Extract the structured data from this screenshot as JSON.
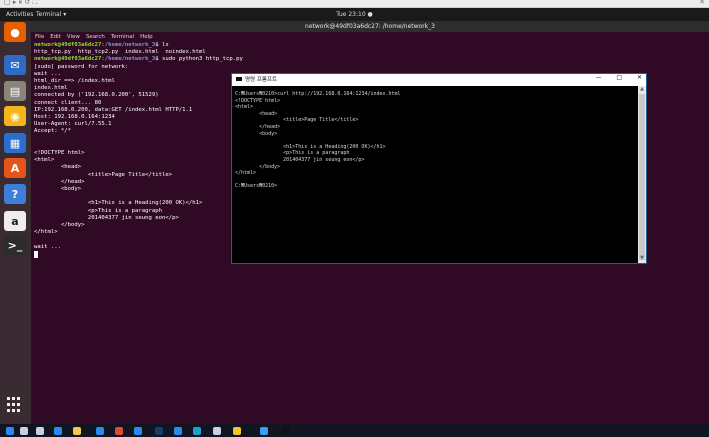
{
  "topbar": {
    "activities": "Activities",
    "app_menu": "Terminal ▾",
    "clock": "Tue 23:10 ●"
  },
  "terminal": {
    "title": "network@49df03a6dc27: /home/network_3",
    "menu": [
      "File",
      "Edit",
      "View",
      "Search",
      "Terminal",
      "Help"
    ],
    "lines": [
      {
        "prompt": "network@49df03a6dc27",
        "path": ":/home/network_3",
        "cmd": "$ ls"
      },
      {
        "text": "http_tcp.py  http_tcp2.py  index.html  noindex.html"
      },
      {
        "prompt": "network@49df03a6dc27",
        "path": ":/home/network_3",
        "cmd": "$ sudo python3 http_tcp.py"
      },
      {
        "text": "[sudo] password for network:"
      },
      {
        "text": "wait ..."
      },
      {
        "text": "html_dir ==> /index.html"
      },
      {
        "text": "index.html"
      },
      {
        "text": "connected by ('192.168.0.200', 51529)"
      },
      {
        "text": "connect client... 80"
      },
      {
        "text": "IP:192.168.0.200, data:GET /index.html HTTP/1.1"
      },
      {
        "text": "Host: 192.168.0.164:1234"
      },
      {
        "text": "User-Agent: curl/7.55.1"
      },
      {
        "text": "Accept: */*"
      },
      {
        "text": ""
      },
      {
        "text": ""
      },
      {
        "text": "<!DOCTYPE html>"
      },
      {
        "text": "<html>"
      },
      {
        "text": "        <head>"
      },
      {
        "text": "                <title>Page Title</title>"
      },
      {
        "text": "        </head>"
      },
      {
        "text": "        <body>"
      },
      {
        "text": ""
      },
      {
        "text": "                <h1>This is a Heading(200 OK)</h1>"
      },
      {
        "text": "                <p>This is a paragraph"
      },
      {
        "text": "                201404377 jin seung eon</p>"
      },
      {
        "text": "        </body>"
      },
      {
        "text": "</html>"
      },
      {
        "text": ""
      },
      {
        "text": "wait ..."
      }
    ]
  },
  "cmd": {
    "title": "명령 프롬프트",
    "controls": [
      "—",
      "□",
      "✕"
    ],
    "lines": [
      "C:₩Users₩0210>curl http://192.168.0.164:1234/index.html",
      "<!DOCTYPE html>",
      "<html>",
      "        <head>",
      "                <title>Page Title</title>",
      "        </head>",
      "        <body>",
      "",
      "                <h1>This is a Heading(200 OK)</h1>",
      "                <p>This is a paragraph",
      "                201404377 jin seung eon</p>",
      "        </body>",
      "</html>",
      "",
      "C:₩Users₩0210>"
    ]
  },
  "launcher": {
    "icons": [
      {
        "name": "firefox-icon",
        "color": "#e66000",
        "glyph": "●"
      },
      {
        "name": "thunderbird-icon",
        "color": "#2f6ac5",
        "glyph": "✉"
      },
      {
        "name": "files-icon",
        "color": "#8a8578",
        "glyph": "▤"
      },
      {
        "name": "rhythmbox-icon",
        "color": "#f2b51c",
        "glyph": "◉"
      },
      {
        "name": "libreoffice-writer-icon",
        "color": "#2a6fcf",
        "glyph": "▦"
      },
      {
        "name": "software-center-icon",
        "color": "#e5541a",
        "glyph": "A"
      },
      {
        "name": "help-icon",
        "color": "#3f7ed8",
        "glyph": "?"
      },
      {
        "name": "amazon-icon",
        "color": "#eeeeee",
        "glyph": "a"
      },
      {
        "name": "terminal-icon",
        "color": "#2c2c2c",
        "glyph": ">_"
      }
    ]
  },
  "taskbar": {
    "items": [
      {
        "name": "windows-start-icon",
        "color": "#2d89ef"
      },
      {
        "name": "search-icon",
        "color": "#c9d2e0"
      },
      {
        "name": "task-view-icon",
        "color": "#c9d2e0"
      },
      {
        "name": "store-icon",
        "color": "#2d89ef"
      },
      {
        "name": "file-explorer-icon",
        "color": "#f2c94c"
      },
      {
        "name": "edge-icon",
        "color": "#2d89ef"
      },
      {
        "name": "chrome-icon",
        "color": "#dd4b39"
      },
      {
        "name": "ie-icon",
        "color": "#2d89ef"
      },
      {
        "name": "app-icon-dark",
        "color": "#1e3a66"
      },
      {
        "name": "app-icon-blue",
        "color": "#2d89ef"
      },
      {
        "name": "app-icon-teal",
        "color": "#1ea0d6"
      },
      {
        "name": "settings-icon",
        "color": "#c9d2e0"
      },
      {
        "name": "app-icon-yellow",
        "color": "#f4c430"
      },
      {
        "name": "vscode-icon",
        "color": "#3aa0f3"
      },
      {
        "name": "cmd-taskbar-icon",
        "color": "#111111"
      }
    ]
  }
}
